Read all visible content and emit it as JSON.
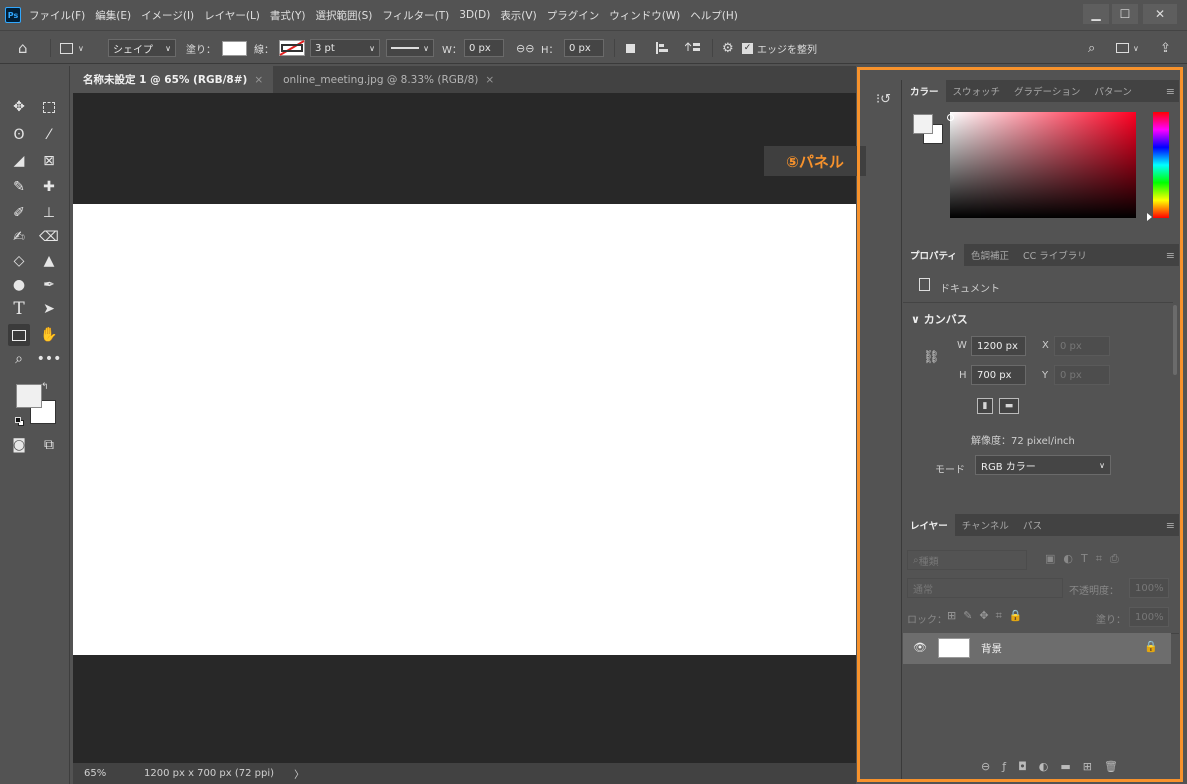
{
  "app": {
    "logo": "Ps",
    "menus": [
      "ファイル(F)",
      "編集(E)",
      "イメージ(I)",
      "レイヤー(L)",
      "書式(Y)",
      "選択範囲(S)",
      "フィルター(T)",
      "3D(D)",
      "表示(V)",
      "プラグイン",
      "ウィンドウ(W)",
      "ヘルプ(H)"
    ]
  },
  "options": {
    "shape_mode": "シェイプ",
    "fill_label": "塗り：",
    "stroke_label": "線：",
    "stroke_width": "3 pt",
    "w_label": "W：",
    "w_value": "0 px",
    "h_label": "H：",
    "h_value": "0 px",
    "align_edges_label": "エッジを整列"
  },
  "tabs": [
    {
      "label": "名称未設定 1 @ 65% (RGB/8#)",
      "active": true
    },
    {
      "label": "online_meeting.jpg @ 8.33% (RGB/8)",
      "active": false
    }
  ],
  "status": {
    "zoom": "65%",
    "doc_size": "1200 px x 700 px (72 ppi)"
  },
  "annotation": "⑤パネル",
  "color_panel": {
    "tabs": [
      "カラー",
      "スウォッチ",
      "グラデーション",
      "パターン"
    ]
  },
  "properties_panel": {
    "tabs": [
      "プロパティ",
      "色調補正",
      "CC ライブラリ"
    ],
    "doc_label": "ドキュメント",
    "section": "カンバス",
    "w_label": "W",
    "w_value": "1200 px",
    "x_label": "X",
    "x_placeholder": "0 px",
    "h_label": "H",
    "h_value": "700 px",
    "y_label": "Y",
    "y_placeholder": "0 px",
    "resolution": "解像度：72 pixel/inch",
    "mode_label": "モード",
    "mode_value": "RGB カラー"
  },
  "layers_panel": {
    "tabs": [
      "レイヤー",
      "チャンネル",
      "パス"
    ],
    "search_placeholder": "種類",
    "blend_mode": "通常",
    "opacity_label": "不透明度：",
    "opacity_value": "100%",
    "lock_label": "ロック：",
    "fill_label": "塗り：",
    "fill_value": "100%",
    "layer_name": "背景"
  }
}
